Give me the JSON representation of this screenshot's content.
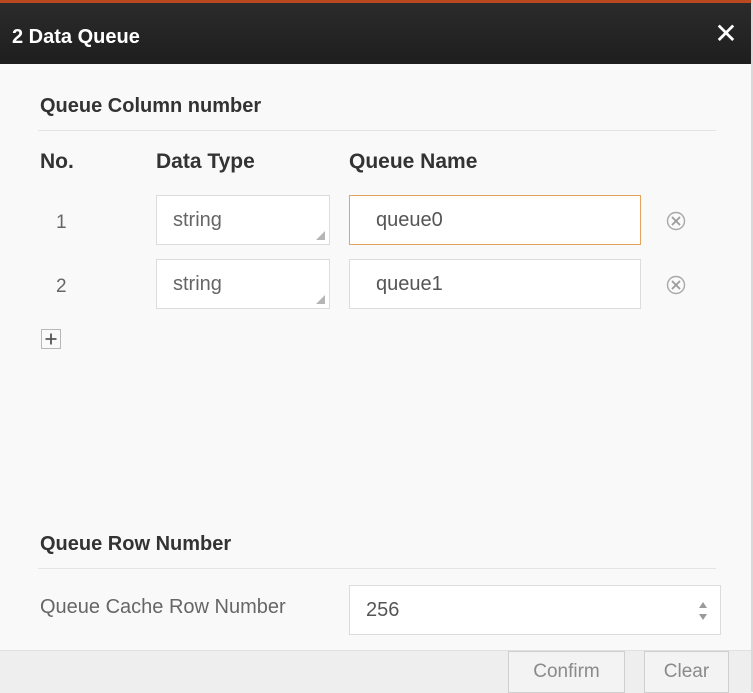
{
  "dialog": {
    "title": "2 Data Queue",
    "close_glyph": "✕"
  },
  "column_section": {
    "title": "Queue Column number",
    "headers": {
      "no": "No.",
      "data_type": "Data Type",
      "queue_name": "Queue Name"
    },
    "rows": [
      {
        "no": "1",
        "data_type": "string",
        "queue_name": "queue0",
        "focused": true
      },
      {
        "no": "2",
        "data_type": "string",
        "queue_name": "queue1",
        "focused": false
      }
    ],
    "add_icon": "plus-icon",
    "remove_icon": "remove-circle-icon"
  },
  "row_section": {
    "title": "Queue Row Number",
    "cache_label": "Queue Cache Row Number",
    "cache_value": "256"
  },
  "footer": {
    "confirm_label": "Confirm",
    "clear_label": "Clear"
  },
  "colors": {
    "titlebar": "#222222",
    "accent_top": "#b94a1f",
    "focus_border": "#e3a35f"
  }
}
